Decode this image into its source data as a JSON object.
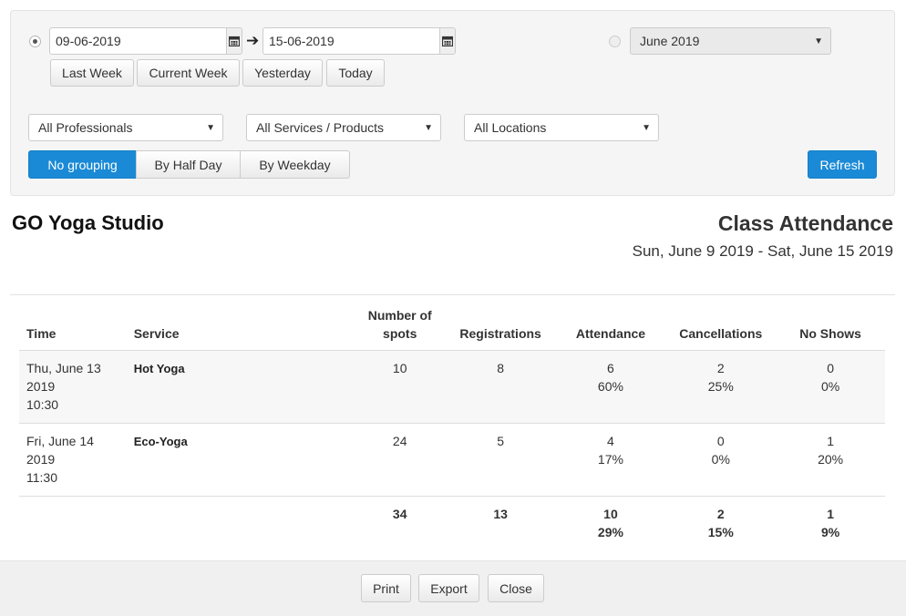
{
  "filters": {
    "range_radio_selected": true,
    "start_date": "09-06-2019",
    "end_date": "15-06-2019",
    "quick_buttons": [
      "Last Week",
      "Current Week",
      "Yesterday",
      "Today"
    ],
    "month_radio_selected": false,
    "month_value": "June 2019",
    "professionals": "All Professionals",
    "services": "All Services / Products",
    "locations": "All Locations",
    "grouping": [
      "No grouping",
      "By Half Day",
      "By Weekday"
    ],
    "grouping_selected": "No grouping",
    "refresh_label": "Refresh"
  },
  "report": {
    "studio_name": "GO Yoga Studio",
    "title": "Class Attendance",
    "date_range": "Sun, June 9 2019 - Sat, June 15 2019"
  },
  "table": {
    "headers": {
      "time": "Time",
      "service": "Service",
      "spots_line1": "Number of",
      "spots_line2": "spots",
      "registrations": "Registrations",
      "attendance": "Attendance",
      "cancellations": "Cancellations",
      "no_shows": "No Shows"
    },
    "rows": [
      {
        "time_line1": "Thu, June 13",
        "time_line2": "2019",
        "time_line3": "10:30",
        "service": "Hot Yoga",
        "spots": "10",
        "registrations": "8",
        "attendance": "6",
        "attendance_pct": "60%",
        "cancellations": "2",
        "cancellations_pct": "25%",
        "no_shows": "0",
        "no_shows_pct": "0%"
      },
      {
        "time_line1": "Fri, June 14",
        "time_line2": "2019",
        "time_line3": "11:30",
        "service": "Eco-Yoga",
        "spots": "24",
        "registrations": "5",
        "attendance": "4",
        "attendance_pct": "17%",
        "cancellations": "0",
        "cancellations_pct": "0%",
        "no_shows": "1",
        "no_shows_pct": "20%"
      }
    ],
    "totals": {
      "spots": "34",
      "registrations": "13",
      "attendance": "10",
      "attendance_pct": "29%",
      "cancellations": "2",
      "cancellations_pct": "15%",
      "no_shows": "1",
      "no_shows_pct": "9%"
    }
  },
  "footer": {
    "print_label": "Print",
    "export_label": "Export",
    "close_label": "Close"
  },
  "colors": {
    "accent": "#1a8ad6",
    "panel_bg": "#f5f5f5",
    "row_band": "#f7f7f7"
  }
}
